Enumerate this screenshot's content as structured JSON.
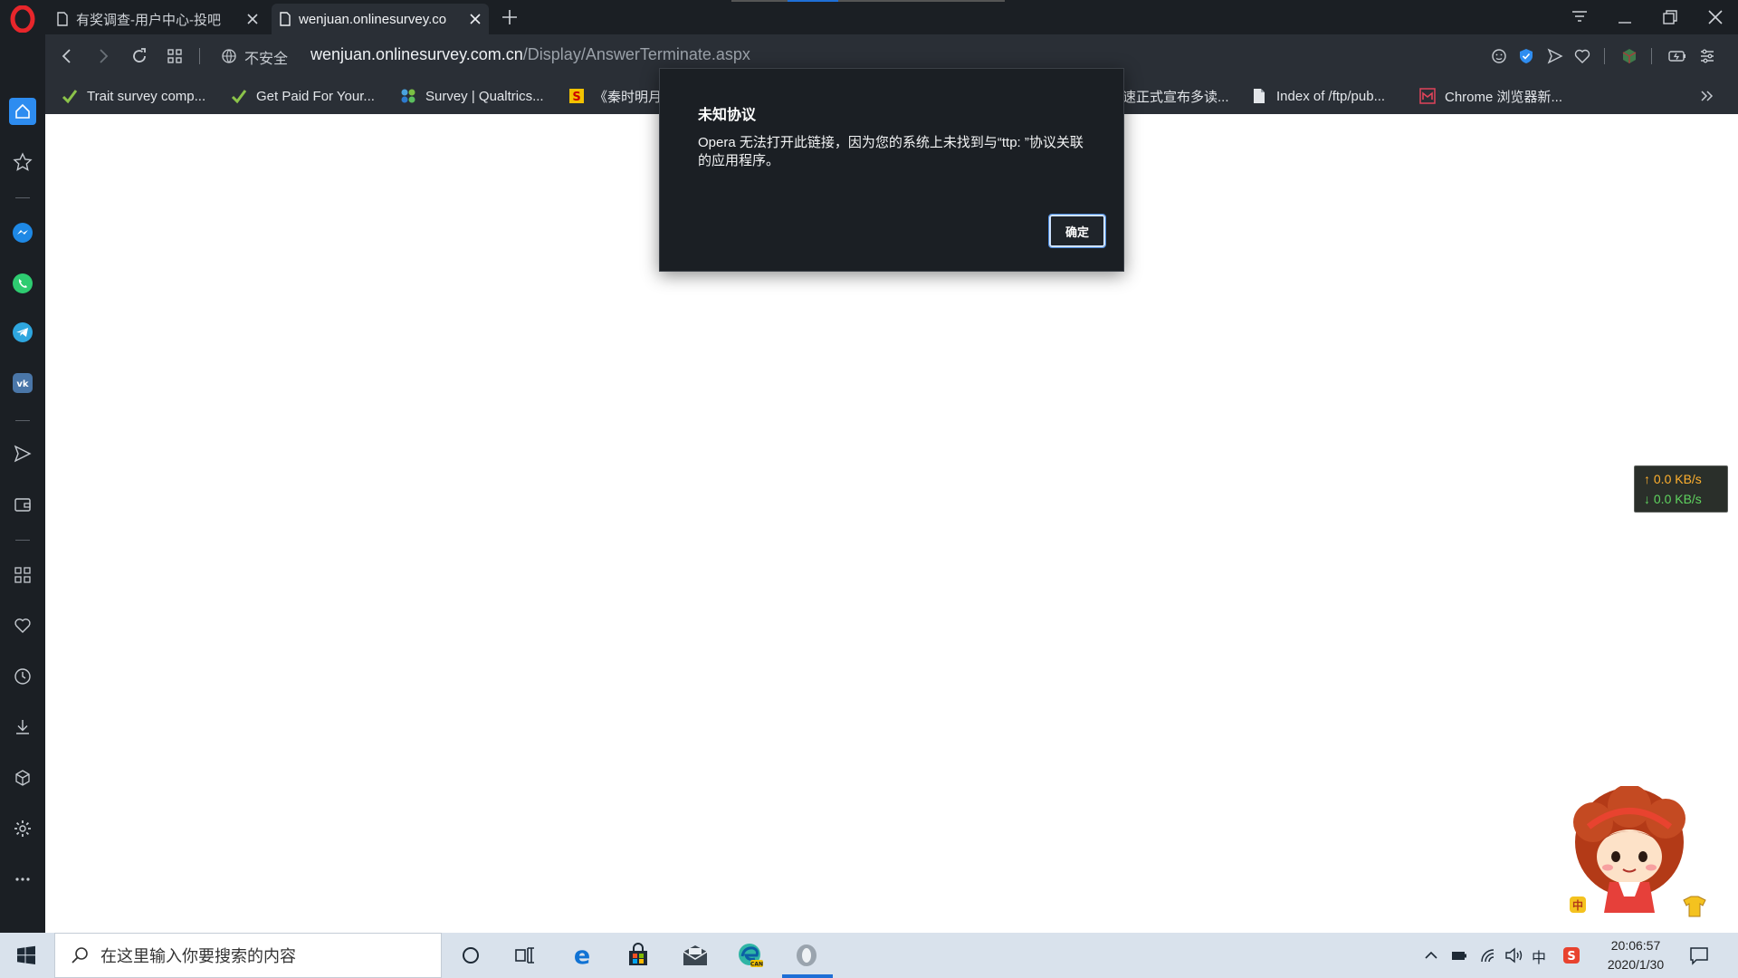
{
  "browser": {
    "tabs": [
      {
        "label": "有奖调查-用户中心-投吧",
        "active": false
      },
      {
        "label": "wenjuan.onlinesurvey.co",
        "active": true
      }
    ],
    "address": {
      "security_label": "不安全",
      "url_host": "wenjuan.onlinesurvey.com.cn",
      "url_path": "/Display/AnswerTerminate.aspx"
    },
    "bookmarks": [
      {
        "label": "Trait survey comp...",
        "icon": "check-icon"
      },
      {
        "label": "Get Paid For Your...",
        "icon": "check-icon"
      },
      {
        "label": "Survey | Qualtrics...",
        "icon": "qualtrics-icon"
      },
      {
        "label": "《秦时明月",
        "icon": "bookmark-site-icon"
      },
      {
        "label": "速正式宣布多读...",
        "icon": "none"
      },
      {
        "label": "Index of /ftp/pub...",
        "icon": "document-icon"
      },
      {
        "label": "Chrome 浏览器新...",
        "icon": "site-icon"
      }
    ]
  },
  "dialog": {
    "title": "未知协议",
    "message": "Opera 无法打开此链接，因为您的系统上未找到与“ttp: ”协议关联的应用程序。",
    "ok_label": "确定"
  },
  "speed_widget": {
    "upload": "↑ 0.0 KB/s",
    "download": "↓ 0.0 KB/s"
  },
  "taskbar": {
    "search_placeholder": "在这里输入你要搜索的内容",
    "time": "20:06:57",
    "date": "2020/1/30",
    "ime": "中"
  },
  "colors": {
    "chrome_dark": "#1b1f24",
    "chrome_mid": "#2a2f36",
    "accent_blue": "#1f6fd6",
    "upload_orange": "#ffb02e",
    "download_green": "#5fd35f"
  }
}
